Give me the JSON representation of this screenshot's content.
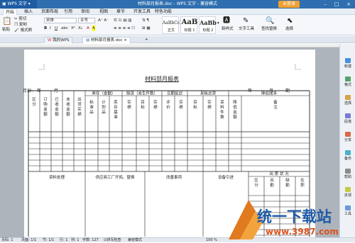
{
  "titlebar": {
    "app_label": "WPS 文字",
    "title": "材料部月报表.doc - WPS 文字 - 兼容模式",
    "login_label": "未登录",
    "controls": [
      "–",
      "□",
      "×"
    ]
  },
  "menubar": {
    "items": [
      "开始",
      "插入",
      "页面布局",
      "引用",
      "审阅",
      "视图",
      "章节",
      "开发工具",
      "特色功能"
    ]
  },
  "ribbon": {
    "paste_label": "粘贴",
    "cut_label": "剪切",
    "copy_label": "复制",
    "format_painter_label": "格式刷",
    "font_name": "宋体",
    "font_size": "五号",
    "styles": [
      {
        "sample": "AaBbCcDd",
        "label": "正文"
      },
      {
        "sample": "AaB",
        "label": "标题 1"
      },
      {
        "sample": "AaBb",
        "label": "标题 2"
      }
    ],
    "new_style_label": "新样式",
    "text_tools_label": "文字工具",
    "find_replace_label": "查找替换",
    "select_label": "选择"
  },
  "tabs": {
    "items": [
      "我的WPS",
      "材料部月报表.doc"
    ],
    "active_index": 1
  },
  "document": {
    "title": "材料部月报表",
    "month_label": "月份:",
    "year_label": "年",
    "month_unit": "月",
    "right_year": "年",
    "right_month": "月",
    "right_period": "期",
    "group_headers": [
      "库存（金额）",
      "缺货（发生件数）",
      "交期延迟",
      "呆帐迟滞",
      "降低成本"
    ],
    "col_headers": [
      "区分",
      "订购金额",
      "已收金额",
      "未收金额",
      "出货实绩",
      "标准品",
      "计划品",
      "库存基准",
      "实绩",
      "目标",
      "实绩",
      "评价",
      "实绩",
      "目标",
      "实绩",
      "呆料件数",
      "降低金额",
      "备注"
    ],
    "bottom_sections": [
      "资料处理",
      "供应商工厂开拓、替换",
      "改善事项",
      "设备引进"
    ],
    "attendance": {
      "title": "出 席 状 况",
      "headers": [
        "区分",
        "出勤",
        "缺勤",
        "在职"
      ]
    }
  },
  "sidebar": {
    "items": [
      "新建",
      "格式",
      "选择",
      "段落",
      "分享",
      "备份",
      "帮助",
      "反馈",
      "工具"
    ]
  },
  "statusbar": {
    "page": "页码: 1",
    "pages": "页面: 1/1",
    "section": "节: 1/1",
    "row": "行: 1",
    "col": "列: 1",
    "chars": "字数: 127",
    "spellcheck": "拼写检查",
    "compat": "兼容模式",
    "zoom": "100 %"
  },
  "watermark": {
    "brand": "统一下载站",
    "url": "www.3987.com"
  },
  "colors": {
    "titlebar": "#2f6fb0",
    "accent": "#f0a030",
    "workspace": "#aeb4bb"
  }
}
